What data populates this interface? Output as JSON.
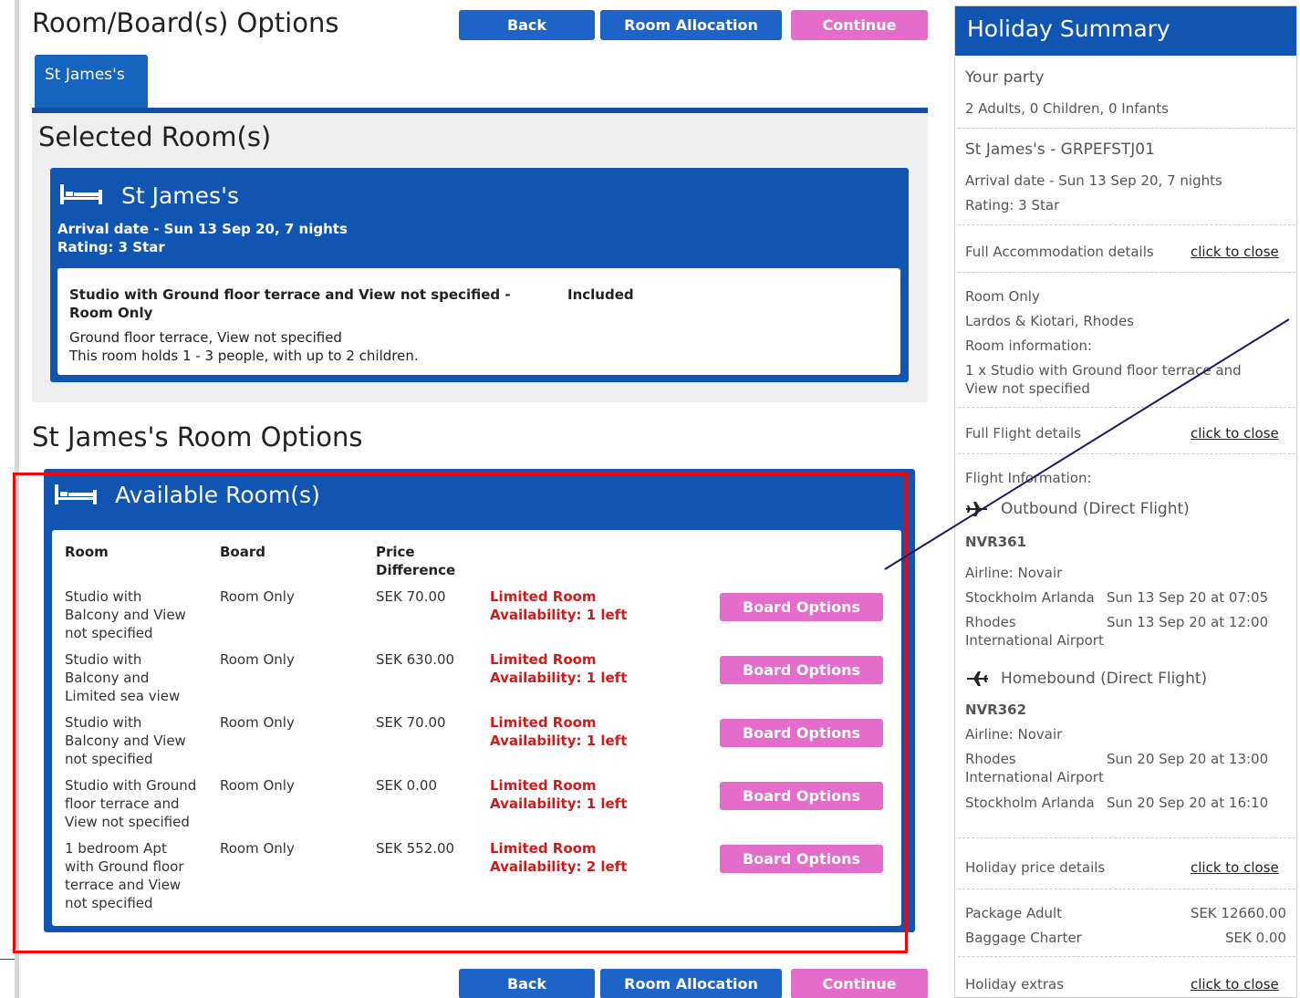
{
  "page": {
    "title": "Room/Board(s) Options",
    "buttons": {
      "back": "Back",
      "room_allocation": "Room Allocation",
      "continue": "Continue"
    },
    "tab": "St James's"
  },
  "selected": {
    "heading": "Selected Room(s)",
    "hotel": "St James's",
    "arrival": "Arrival date - Sun 13 Sep 20, 7 nights",
    "rating": "Rating: 3 Star",
    "room_title_line1": "Studio with Ground floor terrace and View not specified -",
    "room_title_line2": "Room Only",
    "included": "Included",
    "details": "Ground floor terrace, View not specified",
    "capacity": "This room holds 1 - 3 people, with up to 2 children."
  },
  "options": {
    "heading": "St James's Room Options",
    "panel_title": "Available Room(s)",
    "headers": {
      "room": "Room",
      "board": "Board",
      "price_line1": "Price",
      "price_line2": "Difference"
    },
    "rows": [
      {
        "room": [
          "Studio with",
          "Balcony and View",
          "not specified"
        ],
        "board": "Room Only",
        "price": "SEK 70.00",
        "avail1": "Limited Room",
        "avail2": "Availability: 1 left",
        "button": "Board Options"
      },
      {
        "room": [
          "Studio with",
          "Balcony and",
          "Limited sea view"
        ],
        "board": "Room Only",
        "price": "SEK 630.00",
        "avail1": "Limited Room",
        "avail2": "Availability: 1 left",
        "button": "Board Options"
      },
      {
        "room": [
          "Studio with",
          "Balcony and View",
          "not specified"
        ],
        "board": "Room Only",
        "price": "SEK 70.00",
        "avail1": "Limited Room",
        "avail2": "Availability: 1 left",
        "button": "Board Options"
      },
      {
        "room": [
          "Studio with Ground",
          "floor terrace and",
          "View not specified"
        ],
        "board": "Room Only",
        "price": "SEK 0.00",
        "avail1": "Limited Room",
        "avail2": "Availability: 1 left",
        "button": "Board Options"
      },
      {
        "room": [
          "1 bedroom Apt",
          "with Ground floor",
          "terrace and View",
          "not specified"
        ],
        "board": "Room Only",
        "price": "SEK 552.00",
        "avail1": "Limited Room",
        "avail2": "Availability: 2 left",
        "button": "Board Options"
      }
    ]
  },
  "summary": {
    "title": "Holiday Summary",
    "party_label": "Your party",
    "party": "2 Adults, 0 Children, 0 Infants",
    "hotel_code": "St James's - GRPEFSTJ01",
    "arrival": "Arrival date - Sun 13 Sep 20, 7 nights",
    "rating": "Rating: 3 Star",
    "accommodation_label": "Full Accommodation details",
    "click_to_close": "click to close",
    "board": "Room Only",
    "location": "Lardos & Kiotari, Rhodes",
    "room_info_label": "Room information:",
    "room_info_line1": "1 x Studio with Ground floor terrace and",
    "room_info_line2": "View not specified",
    "flight_label": "Full Flight details",
    "flight_info_label": "Flight Information:",
    "outbound": "Outbound (Direct Flight)",
    "outbound_flight": "NVR361",
    "outbound_airline": "Airline:  Novair",
    "outbound_dep_place": "Stockholm Arlanda",
    "outbound_dep_time": "Sun 13 Sep 20 at 07:05",
    "outbound_arr_place1": "Rhodes",
    "outbound_arr_place2": "International Airport",
    "outbound_arr_time": "Sun 13 Sep 20 at 12:00",
    "homebound": "Homebound (Direct Flight)",
    "homebound_flight": "NVR362",
    "homebound_airline": "Airline:  Novair",
    "homebound_dep_place1": "Rhodes",
    "homebound_dep_place2": "International Airport",
    "homebound_dep_time": "Sun 20 Sep 20 at 13:00",
    "homebound_arr_place": "Stockholm Arlanda",
    "homebound_arr_time": "Sun 20 Sep 20 at 16:10",
    "price_label": "Holiday price details",
    "package_adult": "Package Adult",
    "package_adult_price": "SEK 12660.00",
    "baggage": "Baggage Charter",
    "baggage_price": "SEK 0.00",
    "extras_label": "Holiday extras"
  },
  "colors": {
    "brand_blue": "#1155b3",
    "button_blue": "#1e64c8",
    "button_pink": "#e46dcb",
    "availability_red": "#d11a1a",
    "annotation_frame": "#ff0000"
  }
}
